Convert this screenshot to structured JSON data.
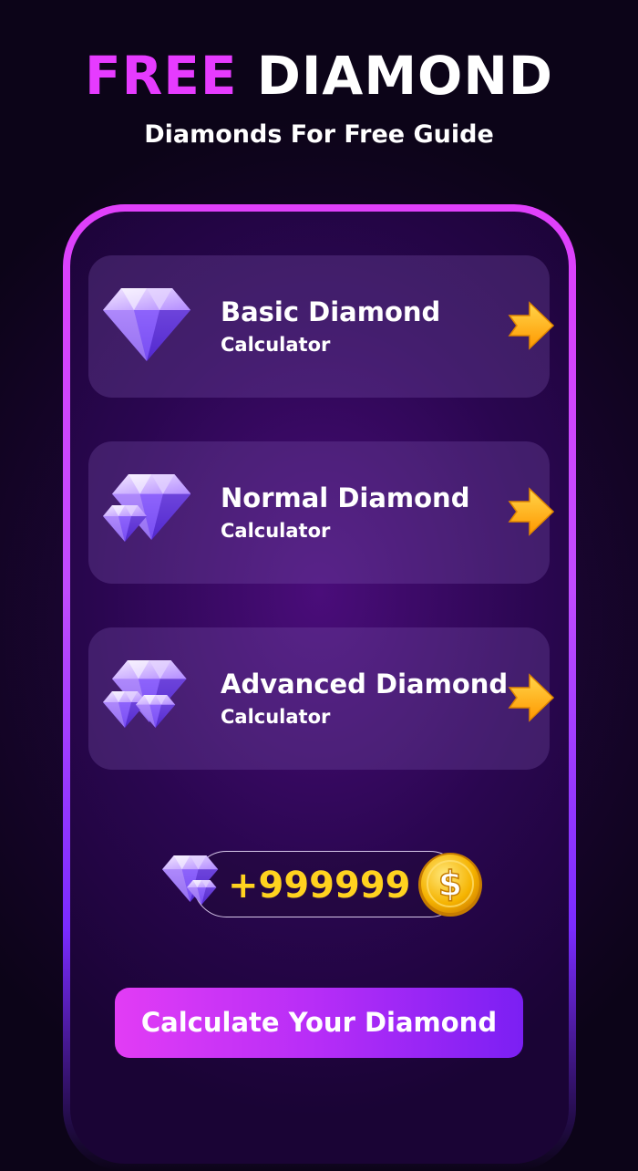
{
  "header": {
    "title_highlight": "FREE",
    "title_rest": "DIAMOND",
    "subtitle": "Diamonds For Free Guide"
  },
  "calculators": [
    {
      "title": "Basic Diamond",
      "subtitle": "Calculator",
      "icon": "diamond-icon"
    },
    {
      "title": "Normal Diamond",
      "subtitle": "Calculator",
      "icon": "diamonds-pair-icon"
    },
    {
      "title": "Advanced Diamond",
      "subtitle": "Calculator",
      "icon": "diamonds-pile-icon"
    }
  ],
  "reward": {
    "value": "+999999",
    "icons": [
      "diamonds-icon",
      "dollar-coin-icon"
    ]
  },
  "cta": {
    "label": "Calculate Your Diamond"
  },
  "colors": {
    "accent_pink": "#e63bff",
    "accent_purple": "#7b1ff3",
    "reward_yellow": "#ffd21f",
    "arrow_orange": "#ffb300"
  }
}
